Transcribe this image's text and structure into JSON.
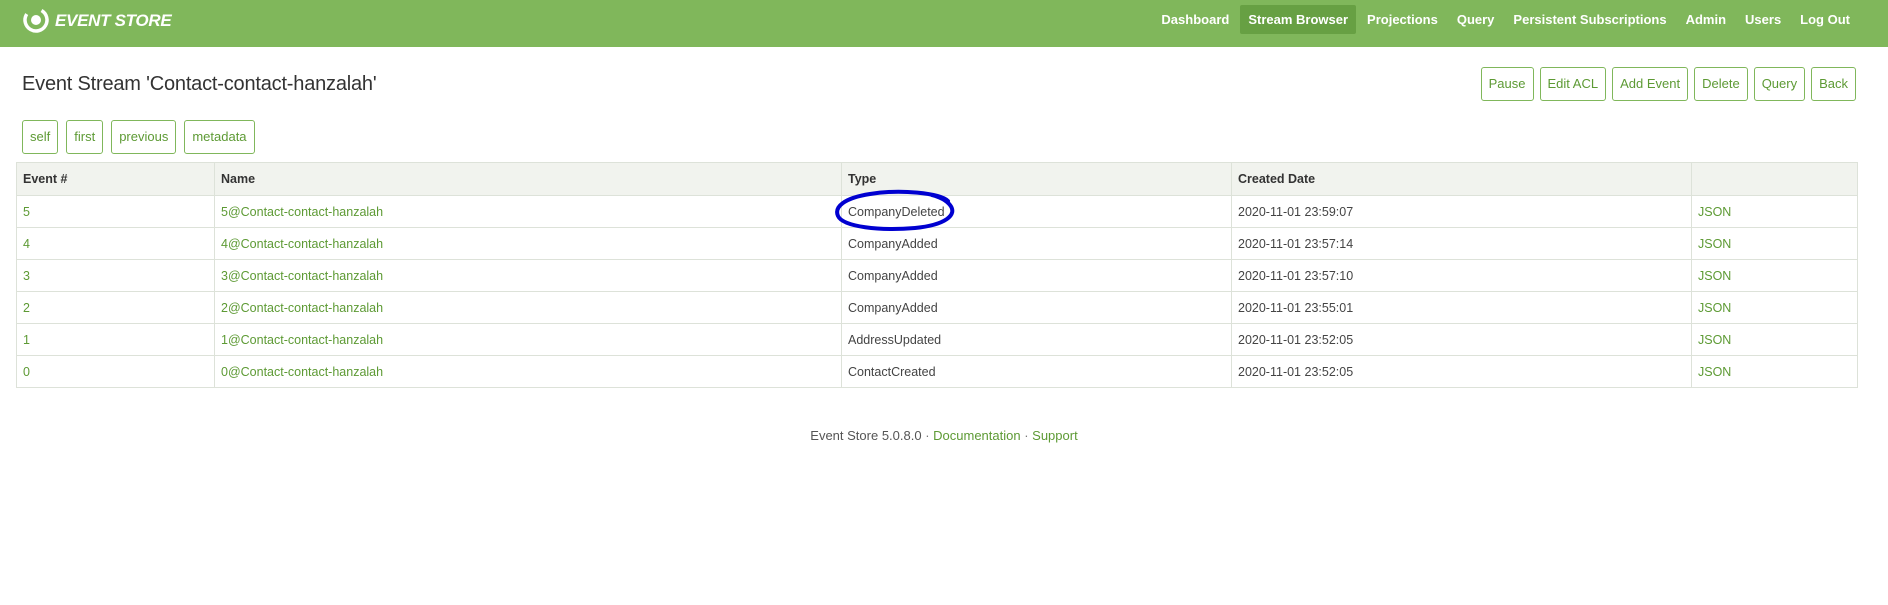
{
  "brand": {
    "name": "EVENT STORE",
    "logo_icon": "eventstore-logo-icon"
  },
  "nav": {
    "items": [
      {
        "label": "Dashboard",
        "active": false
      },
      {
        "label": "Stream Browser",
        "active": true
      },
      {
        "label": "Projections",
        "active": false
      },
      {
        "label": "Query",
        "active": false
      },
      {
        "label": "Persistent Subscriptions",
        "active": false
      },
      {
        "label": "Admin",
        "active": false
      },
      {
        "label": "Users",
        "active": false
      },
      {
        "label": "Log Out",
        "active": false
      }
    ]
  },
  "page": {
    "title": "Event Stream 'Contact-contact-hanzalah'"
  },
  "actions": [
    "Pause",
    "Edit ACL",
    "Add Event",
    "Delete",
    "Query",
    "Back"
  ],
  "pager": [
    "self",
    "first",
    "previous",
    "metadata"
  ],
  "table": {
    "headers": [
      "Event #",
      "Name",
      "Type",
      "Created Date",
      ""
    ],
    "rows": [
      {
        "num": "5",
        "name": "5@Contact-contact-hanzalah",
        "type": "CompanyDeleted",
        "date": "2020-11-01 23:59:07",
        "json": "JSON"
      },
      {
        "num": "4",
        "name": "4@Contact-contact-hanzalah",
        "type": "CompanyAdded",
        "date": "2020-11-01 23:57:14",
        "json": "JSON"
      },
      {
        "num": "3",
        "name": "3@Contact-contact-hanzalah",
        "type": "CompanyAdded",
        "date": "2020-11-01 23:57:10",
        "json": "JSON"
      },
      {
        "num": "2",
        "name": "2@Contact-contact-hanzalah",
        "type": "CompanyAdded",
        "date": "2020-11-01 23:55:01",
        "json": "JSON"
      },
      {
        "num": "1",
        "name": "1@Contact-contact-hanzalah",
        "type": "AddressUpdated",
        "date": "2020-11-01 23:52:05",
        "json": "JSON"
      },
      {
        "num": "0",
        "name": "0@Contact-contact-hanzalah",
        "type": "ContactCreated",
        "date": "2020-11-01 23:52:05",
        "json": "JSON"
      }
    ]
  },
  "annotation": {
    "color": "#0000d0",
    "highlight_row": 0
  },
  "footer": {
    "version": "Event Store 5.0.8.0",
    "separator": " · ",
    "links": [
      "Documentation",
      "Support"
    ]
  },
  "colors": {
    "navbar": "#80b75b",
    "nav_active": "#67a043",
    "link": "#5d9a34"
  }
}
